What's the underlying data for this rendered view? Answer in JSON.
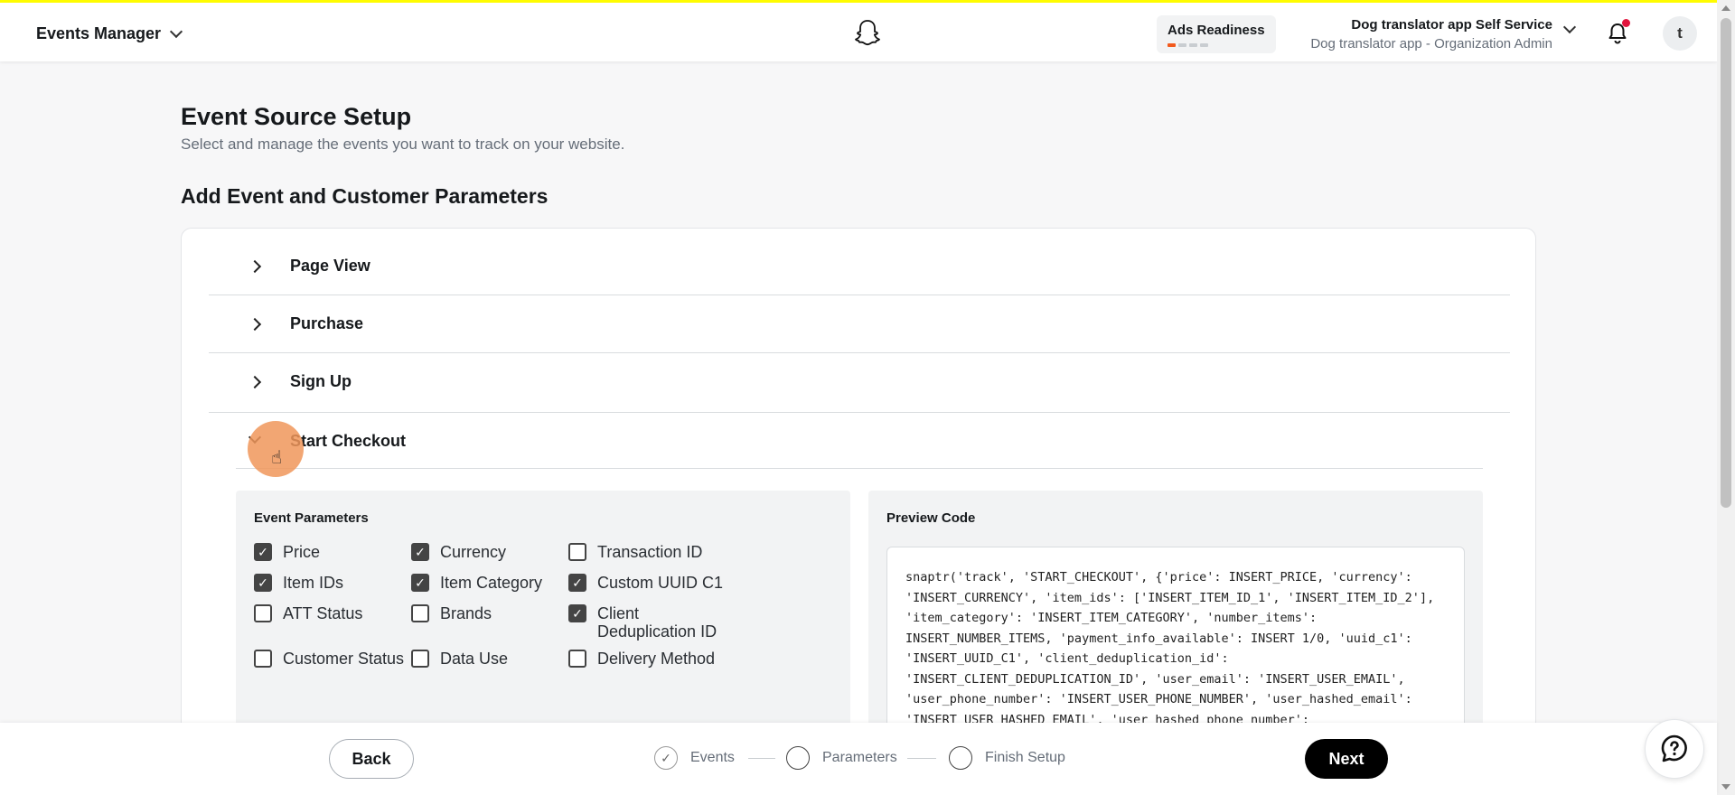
{
  "header": {
    "app_title": "Events Manager",
    "ads_readiness": "Ads Readiness",
    "org_name": "Dog translator app Self Service",
    "org_role": "Dog translator app - Organization Admin",
    "avatar_initial": "t"
  },
  "page": {
    "title": "Event Source Setup",
    "subtitle": "Select and manage the events you want to track on your website.",
    "section_title": "Add Event and Customer Parameters"
  },
  "events": [
    {
      "label": "Page View",
      "expanded": false
    },
    {
      "label": "Purchase",
      "expanded": false
    },
    {
      "label": "Sign Up",
      "expanded": false
    },
    {
      "label": "Start Checkout",
      "expanded": true
    }
  ],
  "event_parameters": {
    "heading": "Event Parameters",
    "items": [
      {
        "label": "Price",
        "checked": true
      },
      {
        "label": "Currency",
        "checked": true
      },
      {
        "label": "Transaction ID",
        "checked": false
      },
      {
        "label": "Item IDs",
        "checked": true
      },
      {
        "label": "Item Category",
        "checked": true
      },
      {
        "label": "Custom UUID C1",
        "checked": true
      },
      {
        "label": "ATT Status",
        "checked": false
      },
      {
        "label": "Brands",
        "checked": false
      },
      {
        "label": "Client Deduplication ID",
        "checked": true
      },
      {
        "label": "Customer Status",
        "checked": false
      },
      {
        "label": "Data Use",
        "checked": false
      },
      {
        "label": "Delivery Method",
        "checked": false
      }
    ]
  },
  "preview": {
    "heading": "Preview Code",
    "code": "snaptr('track', 'START_CHECKOUT', {'price': INSERT_PRICE, 'currency':\n'INSERT_CURRENCY', 'item_ids': ['INSERT_ITEM_ID_1', 'INSERT_ITEM_ID_2'],\n'item_category': 'INSERT_ITEM_CATEGORY', 'number_items':\nINSERT_NUMBER_ITEMS, 'payment_info_available': INSERT 1/0, 'uuid_c1':\n'INSERT_UUID_C1', 'client_deduplication_id':\n'INSERT_CLIENT_DEDUPLICATION_ID', 'user_email': 'INSERT_USER_EMAIL',\n'user_phone_number': 'INSERT_USER_PHONE_NUMBER', 'user_hashed_email':\n'INSERT_USER_HASHED_EMAIL', 'user_hashed_phone_number':"
  },
  "footer": {
    "back_label": "Back",
    "next_label": "Next",
    "steps": [
      {
        "label": "Events",
        "status": "done"
      },
      {
        "label": "Parameters",
        "status": "current"
      },
      {
        "label": "Finish Setup",
        "status": "pending"
      }
    ]
  },
  "colors": {
    "accent_yellow": "#fffc00",
    "notification_red": "#e1143d",
    "readiness_orange": "#f25a1d",
    "primary_button": "#000000"
  }
}
